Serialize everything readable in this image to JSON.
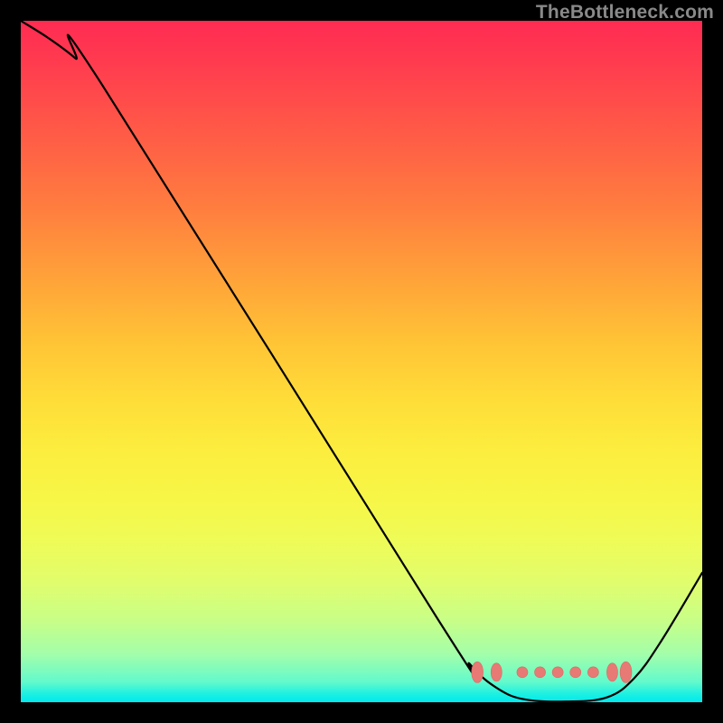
{
  "watermark": "TheBottleneck.com",
  "colors": {
    "curve_stroke": "#000000",
    "marker_fill": "#e77a74",
    "marker_stroke": "#d96a64"
  },
  "chart_data": {
    "type": "line",
    "title": "",
    "xlabel": "",
    "ylabel": "",
    "xlim": [
      0,
      100
    ],
    "ylim": [
      0,
      100
    ],
    "note": "Plot coordinates normalized to a 0–100 space matching the gradient area. The curve dips to a basin (~0%) around x≈74–86 then rises toward the right edge.",
    "curve": [
      {
        "x": 0,
        "y": 100
      },
      {
        "x": 4,
        "y": 97.5
      },
      {
        "x": 8,
        "y": 94.5
      },
      {
        "x": 12,
        "y": 90.5
      },
      {
        "x": 61,
        "y": 12.5
      },
      {
        "x": 66,
        "y": 5.5
      },
      {
        "x": 70,
        "y": 2.0
      },
      {
        "x": 74,
        "y": 0.4
      },
      {
        "x": 80,
        "y": 0.1
      },
      {
        "x": 86,
        "y": 0.7
      },
      {
        "x": 90,
        "y": 3.5
      },
      {
        "x": 94,
        "y": 9.0
      },
      {
        "x": 100,
        "y": 19.0
      }
    ],
    "markers_y_percent": 4.4,
    "markers": [
      {
        "x": 67.0,
        "rx": 0.85,
        "ry": 1.55
      },
      {
        "x": 69.8,
        "rx": 0.8,
        "ry": 1.35
      },
      {
        "x": 73.6,
        "rx": 0.8,
        "ry": 0.8
      },
      {
        "x": 76.2,
        "rx": 0.8,
        "ry": 0.8
      },
      {
        "x": 78.8,
        "rx": 0.8,
        "ry": 0.8
      },
      {
        "x": 81.4,
        "rx": 0.8,
        "ry": 0.8
      },
      {
        "x": 84.0,
        "rx": 0.8,
        "ry": 0.8
      },
      {
        "x": 86.8,
        "rx": 0.8,
        "ry": 1.35
      },
      {
        "x": 88.8,
        "rx": 0.85,
        "ry": 1.55
      }
    ]
  }
}
